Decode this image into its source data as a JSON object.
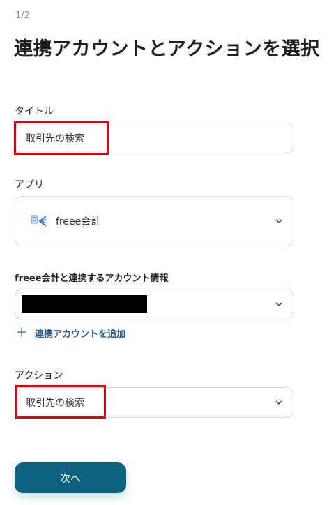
{
  "step_indicator": "1/2",
  "page_title": "連携アカウントとアクションを選択",
  "title_field": {
    "label": "タイトル",
    "value": "取引先の検索"
  },
  "app_field": {
    "label": "アプリ",
    "app_name": "freee会計",
    "app_icon": "freee-app-icon"
  },
  "account_field": {
    "label": "freee会計と連携するアカウント情報",
    "value_redacted": true
  },
  "add_account_link": {
    "icon": "plus-icon",
    "label": "連携アカウントを追加"
  },
  "action_field": {
    "label": "アクション",
    "value": "取引先の検索"
  },
  "next_button": {
    "label": "次へ"
  },
  "colors": {
    "accent": "#0f6380",
    "highlight": "#e60012",
    "link": "#2f5f86"
  }
}
